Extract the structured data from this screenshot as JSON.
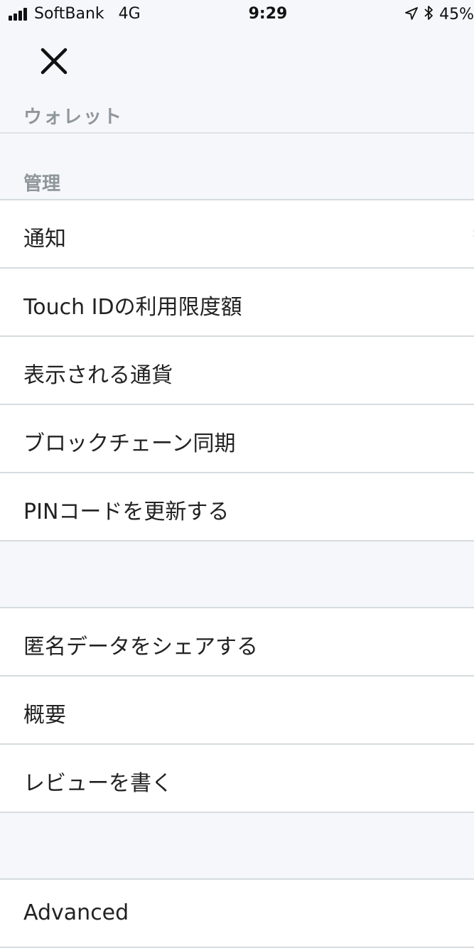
{
  "status_bar": {
    "carrier": "SoftBank",
    "network": "4G",
    "time": "9:29",
    "battery": "45%"
  },
  "header": {
    "wallet_label": "ウォレット"
  },
  "sections": {
    "manage_label": "管理"
  },
  "menu": {
    "notifications": "通知",
    "touch_id_limit": "Touch IDの利用限度額",
    "display_currency": "表示される通貨",
    "blockchain_sync": "ブロックチェーン同期",
    "update_pin": "PINコードを更新する",
    "share_anonymous_data": "匿名データをシェアする",
    "about": "概要",
    "write_review": "レビューを書く",
    "advanced": "Advanced"
  },
  "icons": {
    "close": "close-icon",
    "chevron": "chevron-right-icon",
    "location": "location-arrow-icon",
    "bluetooth": "bluetooth-icon",
    "signal": "signal-bars-icon"
  },
  "colors": {
    "background": "#f5f7fa",
    "row_background": "#ffffff",
    "section_label": "#8f969c",
    "divider": "#d6dcdf"
  }
}
